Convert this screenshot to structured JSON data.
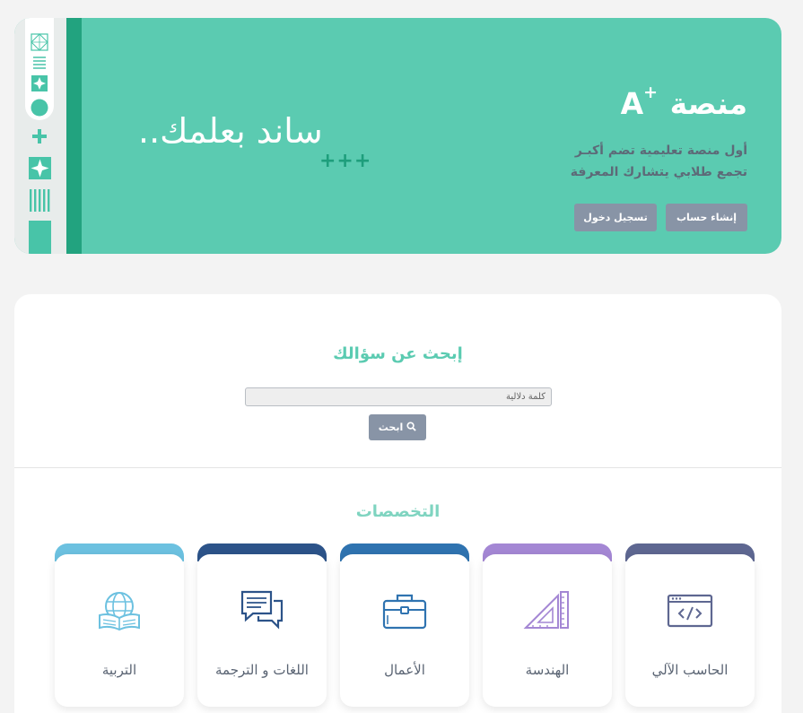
{
  "hero": {
    "title": "منصة",
    "title_mark": "A",
    "title_sup": "+",
    "line1": "أول منصة تعليمية تضم أكبـر",
    "line2": "تجمع طلابي يتشارك المعرفة",
    "signup_label": "إنشاء حساب",
    "login_label": "تسجيل دخول",
    "slogan": "ساند بعلمك..",
    "plusses": "+++",
    "colors": {
      "bg": "#5bcbb1",
      "strip": "#22a37f",
      "button": "#8894a6"
    }
  },
  "search": {
    "heading": "إبحث عن سؤالك",
    "placeholder": "كلمة دلالية",
    "button_label": "ابحث"
  },
  "specializations": {
    "heading": "التخصصات",
    "items": [
      {
        "label": "الحاسب الآلي",
        "icon": "code-window-icon",
        "color": "#5e6791"
      },
      {
        "label": "الهندسة",
        "icon": "ruler-triangle-icon",
        "color": "#a487d4"
      },
      {
        "label": "الأعمال",
        "icon": "briefcase-icon",
        "color": "#2f73b0"
      },
      {
        "label": "اللغات و الترجمة",
        "icon": "chat-bubbles-icon",
        "color": "#2c5389"
      },
      {
        "label": "التربية",
        "icon": "globe-book-icon",
        "color": "#6cc1e0"
      }
    ]
  }
}
